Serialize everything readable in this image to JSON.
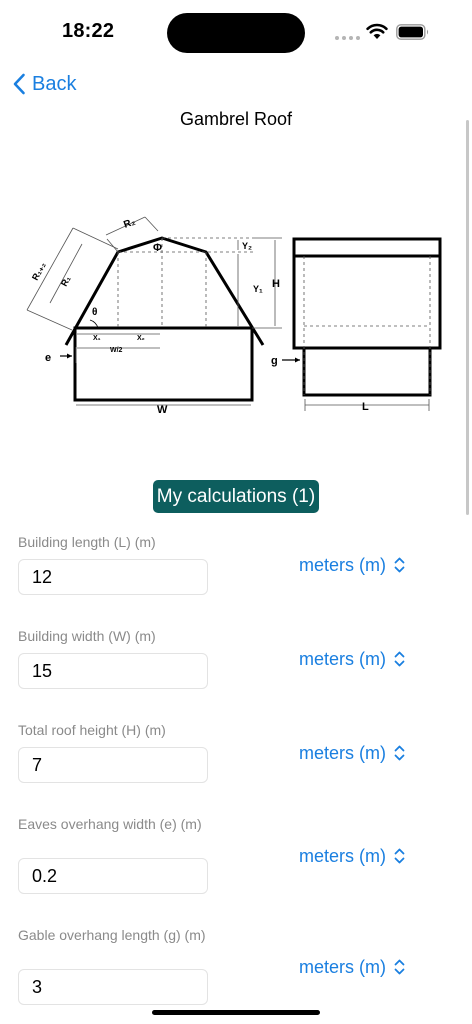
{
  "status": {
    "time": "18:22"
  },
  "nav": {
    "back_label": "Back",
    "title": "Gambrel Roof"
  },
  "diagram": {
    "labels": {
      "r2": "R₂",
      "phi": "Φ",
      "y2": "Y₂",
      "h": "H",
      "y1": "Y₁",
      "r1_r2": "R₁₊₂",
      "r1": "R₁",
      "theta": "θ",
      "x1": "X₁",
      "x2": "X₂",
      "w_half": "W/2",
      "e": "e",
      "w": "W",
      "g": "g",
      "l": "L"
    }
  },
  "calc_button": "My calculations (1)",
  "fields": [
    {
      "label": "Building length (L) (m)",
      "value": "12",
      "unit": "meters (m)"
    },
    {
      "label": "Building width (W) (m)",
      "value": "15",
      "unit": "meters (m)"
    },
    {
      "label": "Total roof height (H) (m)",
      "value": "7",
      "unit": "meters (m)"
    },
    {
      "label": "Eaves overhang width (e) (m)",
      "value": "0.2",
      "unit": "meters (m)"
    },
    {
      "label": "Gable overhang length (g) (m)",
      "value": "3",
      "unit": "meters (m)"
    }
  ]
}
